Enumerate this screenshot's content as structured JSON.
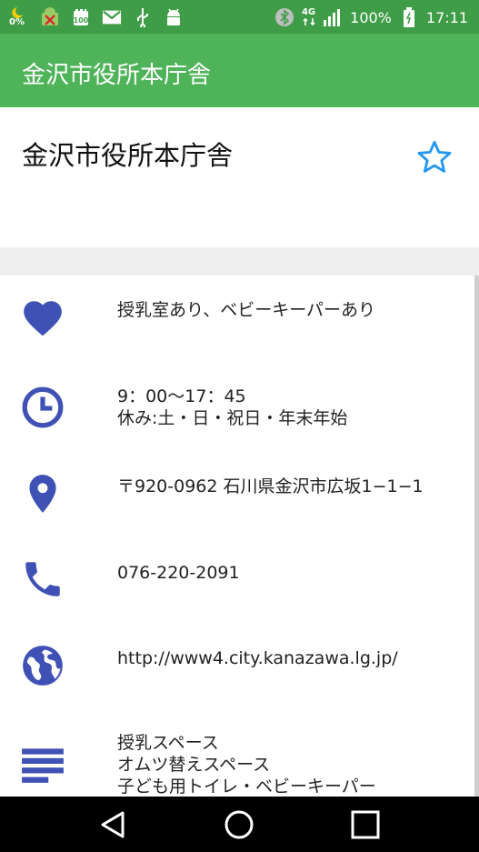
{
  "status_bar": {
    "battery_small_label": "0%",
    "network": "4G",
    "battery_percent": "100%",
    "time": "17:11",
    "icons": [
      "moon-battery-icon",
      "android-blocked-icon",
      "storage-100-icon",
      "gmail-icon",
      "usb-icon",
      "android-icon",
      "bluetooth-icon",
      "network-icon",
      "signal-icon",
      "battery-icon"
    ]
  },
  "app_bar": {
    "title": "金沢市役所本庁舎"
  },
  "header": {
    "name": "金沢市役所本庁舎",
    "favorite_icon": "star-outline-icon"
  },
  "rows": [
    {
      "icon": "heart-icon",
      "lines": [
        "授乳室あり、ベビーキーパーあり"
      ]
    },
    {
      "icon": "clock-icon",
      "lines": [
        "9：00〜17：45",
        "休み:土・日・祝日・年末年始"
      ]
    },
    {
      "icon": "location-pin-icon",
      "lines": [
        "〒920-0962 石川県金沢市広坂1−1−1"
      ]
    },
    {
      "icon": "phone-icon",
      "lines": [
        "076-220-2091"
      ]
    },
    {
      "icon": "globe-icon",
      "lines": [
        "http://www4.city.kanazawa.lg.jp/"
      ]
    },
    {
      "icon": "notes-icon",
      "lines": [
        "授乳スペース",
        "オムツ替えスペース",
        "子ども用トイレ・ベビーキーパー"
      ]
    }
  ],
  "nav_bar": {
    "icons": [
      "back-icon",
      "home-icon",
      "recents-icon"
    ]
  },
  "colors": {
    "status_bar": "#3f9d47",
    "app_bar": "#4fb35a",
    "icon_blue": "#3f51b5",
    "star_blue": "#2196f3"
  }
}
